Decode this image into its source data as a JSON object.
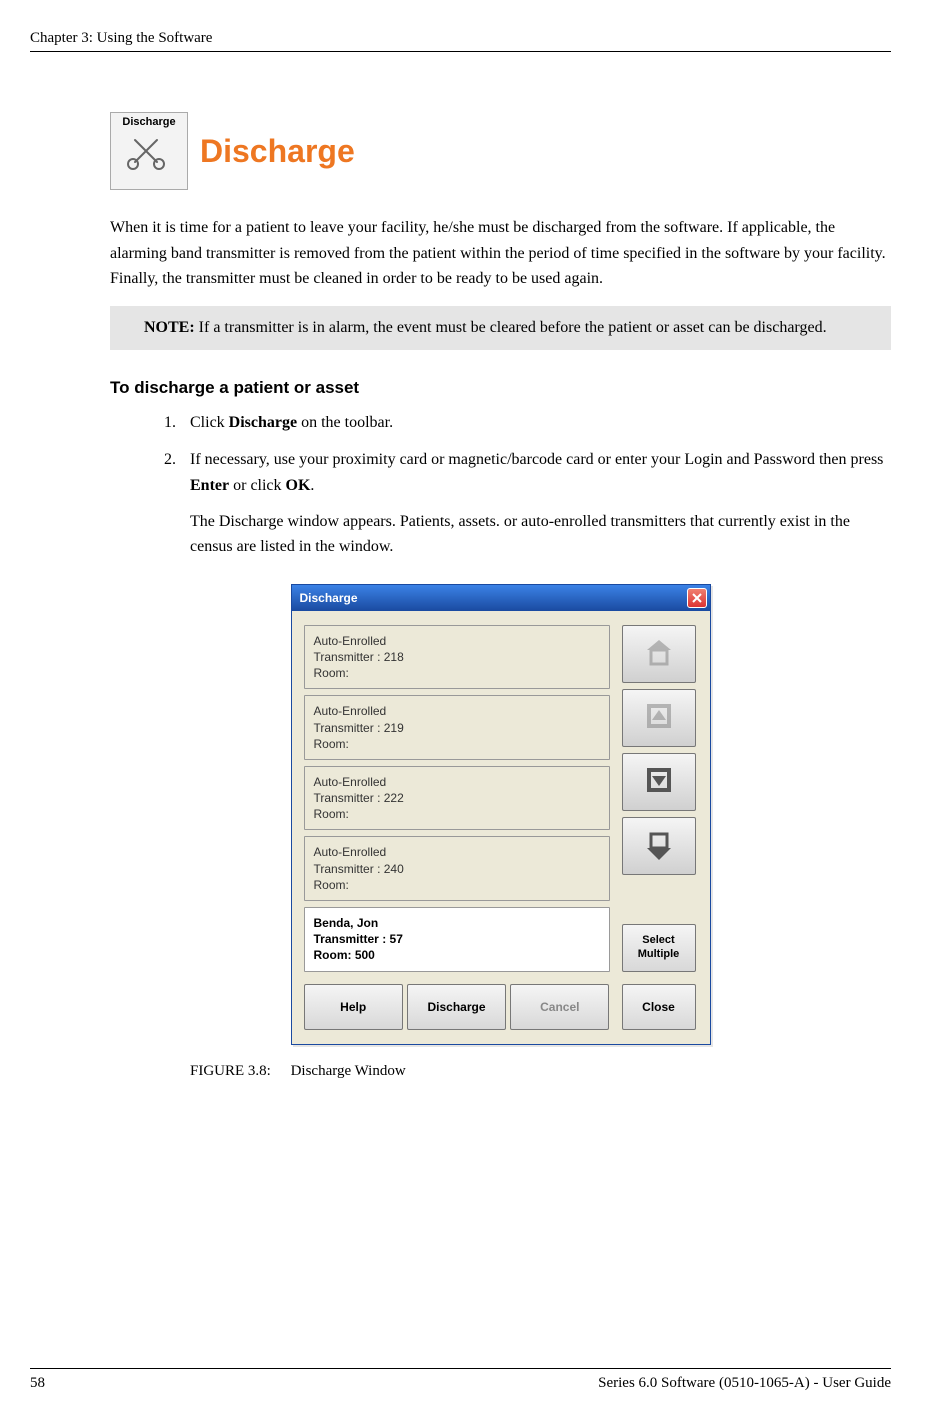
{
  "header": {
    "chapter": "Chapter 3: Using the Software"
  },
  "toolbar_icon_label": "Discharge",
  "section_title": "Discharge",
  "intro_text": "When it is time for a patient to leave your facility, he/she must be discharged from the software. If applicable, the alarming band transmitter is removed from the patient within the period of time specified in the software by your facility. Finally, the transmitter must be cleaned in order to be ready to be used again.",
  "note": {
    "label": "NOTE:",
    "text": "If a transmitter is in alarm, the event must be cleared before the patient or asset can be discharged."
  },
  "subhead": "To discharge a patient or asset",
  "steps": {
    "s1_pre": "Click ",
    "s1_bold": "Discharge",
    "s1_post": " on the toolbar.",
    "s2_pre": "If necessary, use your proximity card or magnetic/barcode card or enter your Login and Password then press ",
    "s2_bold1": "Enter",
    "s2_mid": " or click ",
    "s2_bold2": "OK",
    "s2_post": ".",
    "s2_after": "The Discharge window appears. Patients, assets. or auto-enrolled transmitters that currently exist in the census are listed in the window."
  },
  "dialog": {
    "title": "Discharge",
    "entries": [
      {
        "line1": "Auto-Enrolled",
        "line2": "Transmitter : 218",
        "line3": "Room:",
        "selected": false
      },
      {
        "line1": "Auto-Enrolled",
        "line2": "Transmitter : 219",
        "line3": "Room:",
        "selected": false
      },
      {
        "line1": "Auto-Enrolled",
        "line2": "Transmitter : 222",
        "line3": "Room:",
        "selected": false
      },
      {
        "line1": "Auto-Enrolled",
        "line2": "Transmitter : 240",
        "line3": "Room:",
        "selected": false
      },
      {
        "line1": "Benda, Jon",
        "line2": "Transmitter : 57",
        "line3": "Room: 500",
        "selected": true
      }
    ],
    "buttons": {
      "select_multiple": "Select Multiple",
      "help": "Help",
      "discharge": "Discharge",
      "cancel": "Cancel",
      "close": "Close"
    }
  },
  "figure": {
    "number": "FIGURE 3.8:",
    "caption": "Discharge Window"
  },
  "footer": {
    "page": "58",
    "doc": "Series 6.0 Software (0510-1065-A) - User Guide"
  }
}
